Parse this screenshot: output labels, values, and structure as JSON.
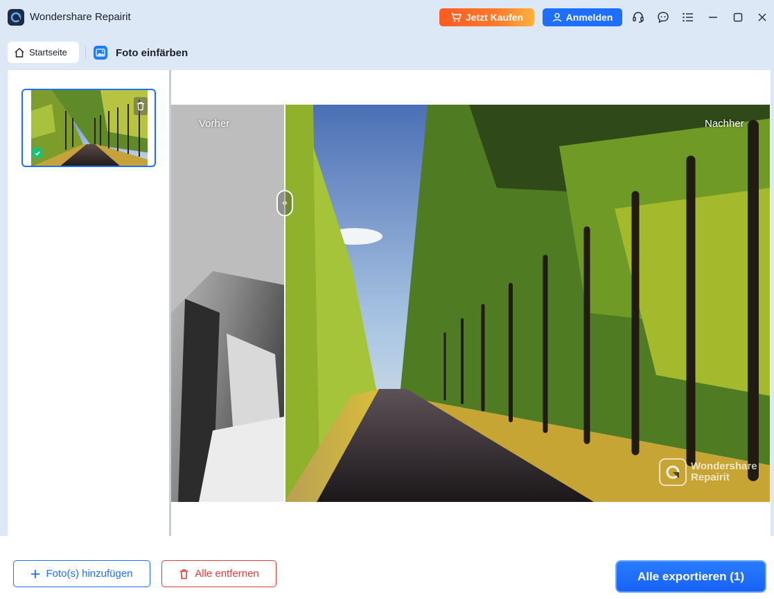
{
  "app": {
    "title": "Wondershare Repairit",
    "logo_icon": "repairit-logo-icon"
  },
  "header": {
    "buy_label": "Jetzt Kaufen",
    "buy_icon": "shopping-cart-icon",
    "login_label": "Anmelden",
    "login_icon": "user-icon",
    "icons": [
      "headset-icon",
      "feedback-icon",
      "menu-list-icon",
      "minimize-icon",
      "maximize-icon",
      "close-icon"
    ],
    "buy_color": "#ff5a1f",
    "login_color": "#1e6fff"
  },
  "tabs": {
    "home_label": "Startseite",
    "home_icon": "home-icon",
    "current_label": "Foto einfärben",
    "current_icon": "image-icon"
  },
  "sidebar": {
    "thumbnail_status": "success",
    "thumbnail_icons": [
      "trash-icon",
      "check-icon"
    ]
  },
  "preview": {
    "before_label": "Vorher",
    "after_label": "Nachher",
    "split_handle_icon": "split-arrows-icon",
    "watermark_line1": "Wondershare",
    "watermark_line2": "Repairit"
  },
  "footer": {
    "add_label": "Foto(s) hinzufügen",
    "add_icon": "plus-icon",
    "remove_label": "Alle entfernen",
    "remove_icon": "trash-icon",
    "export_label": "Alle exportieren (1)",
    "accent_color": "#1e6fff",
    "danger_color": "#e23b3b"
  }
}
